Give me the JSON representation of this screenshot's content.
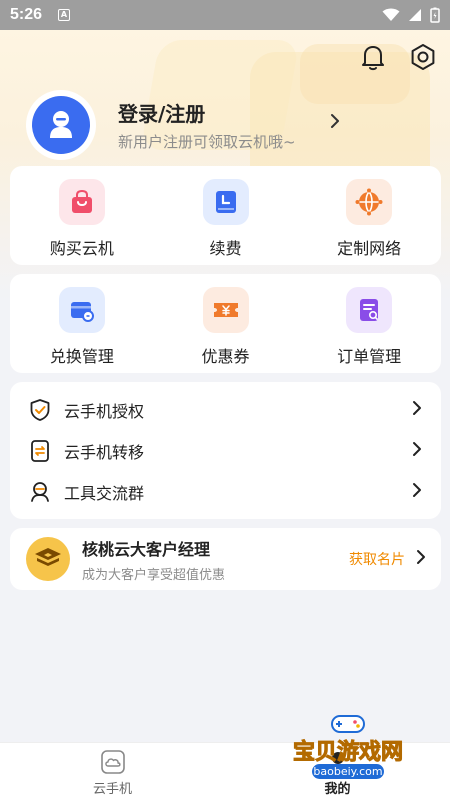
{
  "status_bar": {
    "time": "5:26",
    "notification_icon": "A",
    "icons": [
      "wifi-icon",
      "signal-icon",
      "battery-icon"
    ]
  },
  "header": {
    "icons": [
      "bell-icon",
      "settings-icon"
    ]
  },
  "profile": {
    "title": "登录/注册",
    "subtitle": "新用户注册可领取云机哦~"
  },
  "grid1": [
    {
      "label": "购买云机",
      "icon": "shopping-bag-icon",
      "color": "#f04e6a",
      "bg": "#fde6ea"
    },
    {
      "label": "续费",
      "icon": "renew-clock-icon",
      "color": "#3a6cf0",
      "bg": "#e3ecfe"
    },
    {
      "label": "定制网络",
      "icon": "network-globe-icon",
      "color": "#f07a2c",
      "bg": "#fdebe0"
    }
  ],
  "grid2": [
    {
      "label": "兑换管理",
      "icon": "redeem-card-icon",
      "color": "#3a6cf0",
      "bg": "#e3ecfe"
    },
    {
      "label": "优惠券",
      "icon": "coupon-icon",
      "color": "#f07a2c",
      "bg": "#fdebe0"
    },
    {
      "label": "订单管理",
      "icon": "order-list-icon",
      "color": "#8a4de8",
      "bg": "#efe6fd"
    }
  ],
  "list": [
    {
      "label": "云手机授权",
      "icon": "shield-check-icon"
    },
    {
      "label": "云手机转移",
      "icon": "transfer-icon"
    },
    {
      "label": "工具交流群",
      "icon": "chat-group-icon"
    }
  ],
  "manager": {
    "title": "核桃云大客户经理",
    "subtitle": "成为大客户享受超值优惠",
    "action": "获取名片"
  },
  "nav": [
    {
      "label": "云手机",
      "icon": "cloud-phone-icon",
      "active": false
    },
    {
      "label": "我的",
      "icon": "profile-icon",
      "active": true
    }
  ],
  "watermark": {
    "title": "宝贝游戏网",
    "url": "baobeiy.com"
  }
}
